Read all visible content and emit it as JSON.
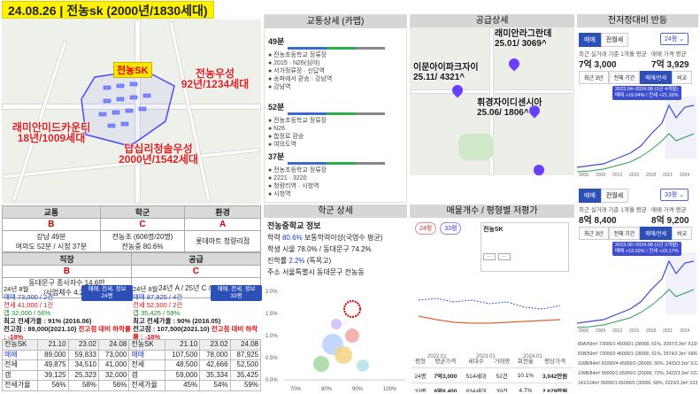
{
  "title": "24.08.26 | 전농sk (2000년/1830세대)",
  "map": {
    "target": "전농SK",
    "labels": [
      {
        "t": "전농우성",
        "s": "92년/1234세대"
      },
      {
        "t": "래미안미드카운티",
        "s": "18년/1009세대"
      },
      {
        "t": "답십리청솔우성",
        "s": "2000년/1542세대"
      }
    ]
  },
  "grade": {
    "h1": [
      "교통",
      "학군",
      "환경"
    ],
    "g1": [
      "B",
      "C",
      "A"
    ],
    "d1a": "강남 49분",
    "d1b": "여의도 52분 / 시청 37분",
    "d2a": "전농초 (606명/20명)",
    "d2b": "전농중 80.6%",
    "d3": "롯데마트 청량리점",
    "h2": [
      "직장",
      "공급"
    ],
    "g2": [
      "B",
      "C"
    ],
    "d4a": "동대문구 종사자수 14.6만",
    "d4b": "/사업체수 4.2만",
    "d5": "24년 A / 25년 C / 26년 A"
  },
  "stats": [
    {
      "month": "24년 8월",
      "pill": "매매, 전세, 정보",
      "area": "24평",
      "sale": "매매 73,000 / 2건",
      "jeon": "전세 41,000 / 1건",
      "gap": "갭 32,000 / 56%",
      "peak": "최고 전세가율 : 91% (2016.06)",
      "pk2": "전고점 : 89,000(2021.10)",
      "drop": "전고점 대비 하락률 : -18%"
    },
    {
      "month": "24년 8월",
      "pill": "매매, 전세, 정보",
      "area": "33평",
      "sale": "매매 87,925 / 4건",
      "jeon": "전세 52,500 / 2건",
      "gap": "갭 35,425 / 59%",
      "peak": "최고 전세가율 : 90% (2016.05)",
      "pk2": "전고점 : 107,500(2021.10)",
      "drop": "전고점 대비 하락률 : -18%"
    }
  ],
  "ptable": [
    {
      "head": [
        "전농SK",
        "21.10",
        "23.02",
        "24.08"
      ],
      "rows": [
        [
          "매매",
          "89,000",
          "59,833",
          "73,000"
        ],
        [
          "전세",
          "49,875",
          "34,510",
          "41,000"
        ],
        [
          "갭",
          "39,125",
          "25,323",
          "32,000"
        ],
        [
          "전세가율",
          "56%",
          "58%",
          "56%"
        ]
      ]
    },
    {
      "head": [
        "전농SK",
        "21.10",
        "23.02",
        "24.08"
      ],
      "rows": [
        [
          "매매",
          "107,500",
          "78,000",
          "87,925"
        ],
        [
          "전세",
          "48,500",
          "42,666",
          "52,500"
        ],
        [
          "갭",
          "59,000",
          "35,334",
          "35,425"
        ],
        [
          "전세가율",
          "45%",
          "54%",
          "59%"
        ]
      ]
    }
  ],
  "transit": {
    "header": "교통상세 (카맵)",
    "routes": [
      {
        "time": "49분",
        "steps": [
          "전농초등학교 정류장",
          "2015 · N26(심야)",
          "서가정류장 · 신답역",
          "송파에서 환승 · 강남역",
          "강남역"
        ]
      },
      {
        "time": "52분",
        "steps": [
          "전농초등학교 정류장",
          "N26",
          "합정로 환승",
          "여의도역"
        ]
      },
      {
        "time": "37분",
        "steps": [
          "전농초등학교 정류장",
          "2221 · 3220",
          "청량리역 · 시청역",
          "시청역"
        ]
      }
    ]
  },
  "supply": {
    "header": "공급상세",
    "labels": [
      {
        "t": "래미안라그란데",
        "s": "25.01/ 3069^"
      },
      {
        "t": "이문아이파크자이",
        "s": "25.11/ 4321^"
      },
      {
        "t": "휘경자이디센시아",
        "s": "25.06/ 1806^"
      }
    ]
  },
  "school": {
    "header": "학군 상세",
    "name": "전농중학교 정보",
    "l1a": "학력 ",
    "l1b": "80.6%",
    "l1c": " 보통학력이상(국영수 평균)",
    "l2": "학생 시울 78.0% / 동대문구 74.2%",
    "l3a": "진학률 ",
    "l3b": "2.2%",
    "l3c": " (특목고)",
    "l4": "주소 서울특별시 동대문구 전농동",
    "yticks": [
      "2.0%",
      "1.5%",
      "1.0%",
      "0.5%",
      "0.0%"
    ],
    "xticks": [
      "70%",
      "80%",
      "90%",
      "100%"
    ]
  },
  "listing": {
    "header": "매물개수 / 평형별 저평가",
    "chips": [
      "24평",
      "33평"
    ],
    "legend": "전농SK",
    "cols": [
      "평형",
      "평균가격",
      "세대수",
      "거래량",
      "회전율",
      "평당가격"
    ],
    "rows": [
      [
        "24평",
        "7억3,000",
        "514세대",
        "52건",
        "10.1%",
        "3,042만원"
      ],
      [
        "33평",
        "8억8,400",
        "834세대",
        "39건",
        "4.7%",
        "2,679만원"
      ]
    ],
    "xlabels": [
      "2022.01",
      "2023.01",
      "2024.01"
    ]
  },
  "rent": {
    "header": "전저정대비 반등",
    "blocks": [
      {
        "area": "24평",
        "tabs": [
          "매매",
          "전월세"
        ],
        "lab1": "최근 실거래 기준 1개월 평균",
        "p1": "7억 3,000",
        "lab2": "매매 가격 평균",
        "p2": "7억 3,929",
        "ann": "2023.04~2024.08 (1년 4개월)",
        "ann2": "매매 +19.04% / 전세 +21.35%"
      },
      {
        "area": "33평",
        "tabs": [
          "매매",
          "전월세"
        ],
        "lab1": "최근 실거래 기준 1개월 평균",
        "p1": "8억 8,400",
        "lab2": "매매 가격 평균",
        "p2": "8억 9,200",
        "ann": "2023.06~2024.08 (1년 2개월)",
        "ann2": "매매 +13.32% / 전세 +23.17%"
      }
    ],
    "ranges": [
      "최근 3년",
      "전체 기간",
      "매매/전세",
      "비교"
    ],
    "years": [
      "2006",
      "2009",
      "2012",
      "2015",
      "2018",
      "2021",
      "2024"
    ],
    "txs": [
      "80A/59m² 73000/1 45000/1 (28000, 61%, 2097/3.3m² X13/7)",
      "81B/59m² 73000/2 45000/1 (28000, 61%, 2974/3.3m² X8/6)",
      "109B/84m² 81000/4 45000/2 (36000, 56%, 2433/3.3m² X12/6)",
      "109B/84m² 90000/1 65000/1 (25000, 72%, 2422/3.3m² X22/4)",
      "141/114m² 95000/1 65000/2 (30000, 68%, 2223/3.3m² X23/1)"
    ]
  }
}
